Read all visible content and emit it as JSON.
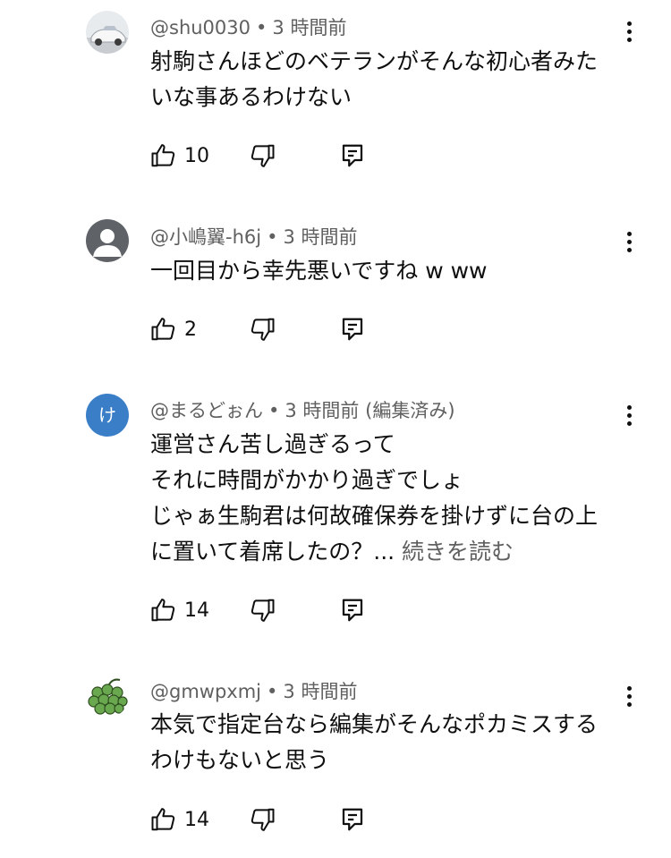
{
  "colors": {
    "text": "#0f0f0f",
    "secondary": "#606060",
    "avatar_blue": "#3a7ec8",
    "avatar_gray": "#5f6368",
    "avatar_green": "#6aa84f"
  },
  "comments": [
    {
      "author": "@shu0030",
      "time": "3 時間前",
      "edited": "",
      "avatar_icon": "car-photo-avatar",
      "lines": [
        "射駒さんほどのベテランがそんな初心者みた",
        "いな事あるわけない"
      ],
      "read_more": "",
      "likes": "10"
    },
    {
      "author": "@小嶋翼-h6j",
      "time": "3 時間前",
      "edited": "",
      "avatar_icon": "default-person-avatar",
      "lines": [
        "一回目から幸先悪いですね w ww"
      ],
      "read_more": "",
      "likes": "2"
    },
    {
      "author": "@まるどぉん",
      "time": "3 時間前",
      "edited": "(編集済み)",
      "avatar_letter": "け",
      "lines": [
        "運営さん苦し過ぎるって",
        "それに時間がかかり過ぎでしょ",
        "じゃぁ生駒君は何故確保券を掛けずに台の上",
        "に置いて着席したの？..."
      ],
      "read_more": "続きを読む",
      "likes": "14"
    },
    {
      "author": "@gmwpxmj",
      "time": "3 時間前",
      "edited": "",
      "avatar_icon": "grapes-avatar",
      "lines": [
        "本気で指定台なら編集がそんなポカミスする",
        "わけもないと思う"
      ],
      "read_more": "",
      "likes": "14"
    }
  ]
}
